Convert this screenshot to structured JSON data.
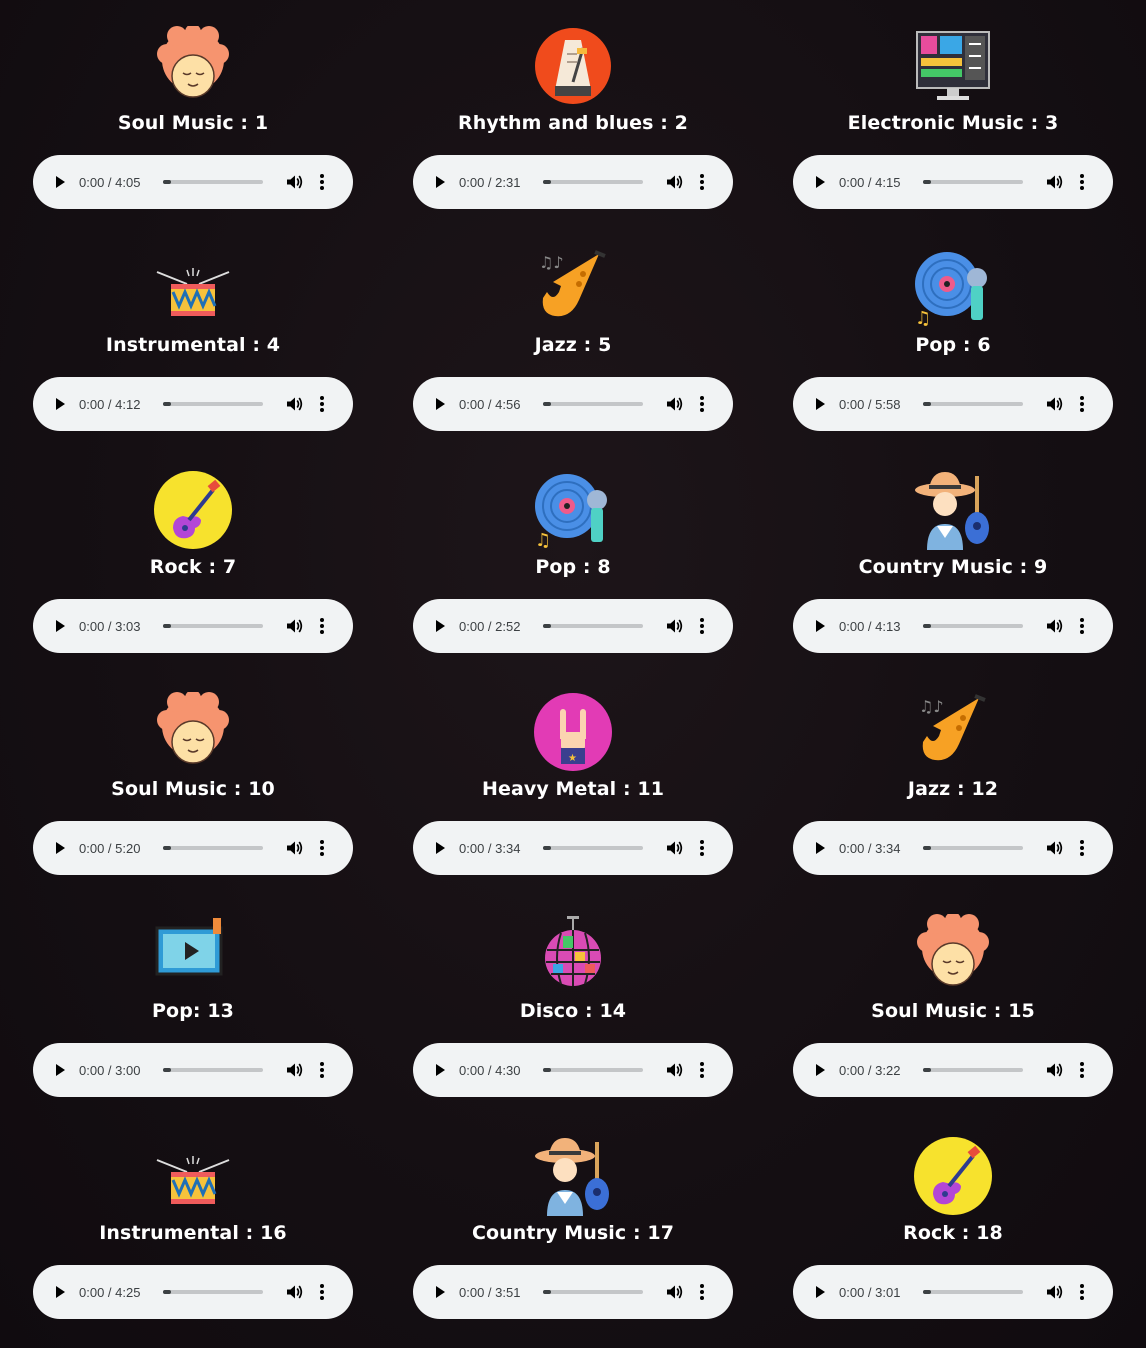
{
  "tracks": [
    {
      "title": "Soul Music : 1",
      "icon": "afro-face-icon",
      "time": "0:00 / 4:05"
    },
    {
      "title": "Rhythm and blues : 2",
      "icon": "metronome-icon",
      "time": "0:00 / 2:31"
    },
    {
      "title": "Electronic Music : 3",
      "icon": "mixer-console-icon",
      "time": "0:00 / 4:15"
    },
    {
      "title": "Instrumental : 4",
      "icon": "drum-icon",
      "time": "0:00 / 4:12"
    },
    {
      "title": "Jazz : 5",
      "icon": "saxophone-icon",
      "time": "0:00 / 4:56"
    },
    {
      "title": "Pop : 6",
      "icon": "vinyl-microphone-icon",
      "time": "0:00 / 5:58"
    },
    {
      "title": "Rock : 7",
      "icon": "electric-guitar-icon",
      "time": "0:00 / 3:03"
    },
    {
      "title": "Pop : 8",
      "icon": "vinyl-microphone-icon",
      "time": "0:00 / 2:52"
    },
    {
      "title": "Country Music : 9",
      "icon": "cowboy-guitar-icon",
      "time": "0:00 / 4:13"
    },
    {
      "title": "Soul Music : 10",
      "icon": "afro-face-icon",
      "time": "0:00 / 5:20"
    },
    {
      "title": "Heavy Metal : 11",
      "icon": "rock-hand-icon",
      "time": "0:00 / 3:34"
    },
    {
      "title": "Jazz : 12",
      "icon": "saxophone-icon",
      "time": "0:00 / 3:34"
    },
    {
      "title": "Pop: 13",
      "icon": "video-player-icon",
      "time": "0:00 / 3:00"
    },
    {
      "title": "Disco : 14",
      "icon": "disco-ball-icon",
      "time": "0:00 / 4:30"
    },
    {
      "title": "Soul Music : 15",
      "icon": "afro-face-icon",
      "time": "0:00 / 3:22"
    },
    {
      "title": "Instrumental : 16",
      "icon": "drum-icon",
      "time": "0:00 / 4:25"
    },
    {
      "title": "Country Music : 17",
      "icon": "cowboy-guitar-icon",
      "time": "0:00 / 3:51"
    },
    {
      "title": "Rock : 18",
      "icon": "electric-guitar-icon",
      "time": "0:00 / 3:01"
    }
  ],
  "colors": {
    "background": "#150f13",
    "player": "#f1f3f4",
    "title": "#ffffff"
  }
}
